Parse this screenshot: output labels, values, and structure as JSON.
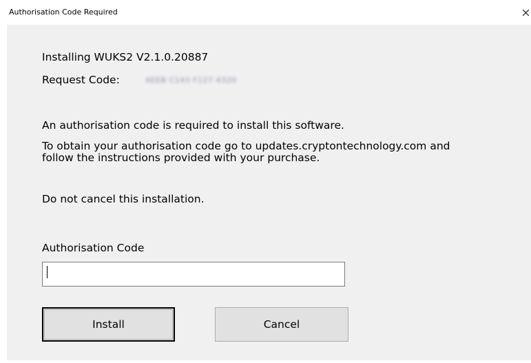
{
  "window": {
    "title": "Authorisation Code Required"
  },
  "content": {
    "installing": "Installing WUKS2 V2.1.0.20887",
    "request_code_label": "Request Code:",
    "request_code_value": "4EEB C143 F127 4320",
    "required_text": "An authorisation code is required to install this software.",
    "obtain_text": "To obtain your authorisation code go to updates.cryptontechnology.com and follow the instructions provided with your purchase.",
    "cancel_warning": "Do not cancel this installation."
  },
  "form": {
    "auth_label": "Authorisation Code",
    "auth_value": ""
  },
  "buttons": {
    "install": "Install",
    "cancel": "Cancel"
  }
}
